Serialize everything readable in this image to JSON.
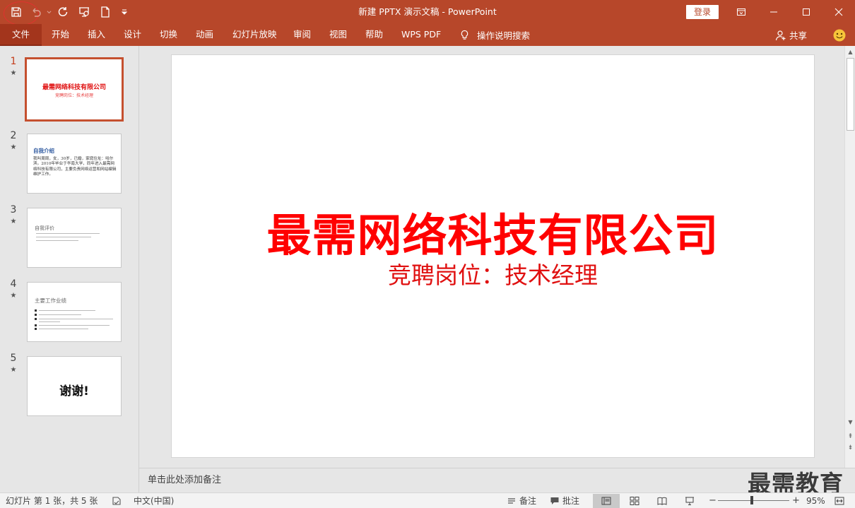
{
  "window": {
    "title": "新建 PPTX 演示文稿  -  PowerPoint",
    "login_label": "登录"
  },
  "ribbon": {
    "file_tab": "文件",
    "tabs": [
      "开始",
      "插入",
      "设计",
      "切换",
      "动画",
      "幻灯片放映",
      "审阅",
      "视图",
      "帮助",
      "WPS PDF"
    ],
    "search_label": "操作说明搜索",
    "share_label": "共享"
  },
  "thumbnails": [
    {
      "number": "1",
      "title": "最需网络科技有限公司",
      "subtitle": "竞聘岗位：技术经理"
    },
    {
      "number": "2",
      "heading": "自我介绍",
      "body": "我叫周周，女，30岁，已婚，家庭住址：哈尔滨。2010年毕业于华南大学，同年进入最需网络科技有限公司，主要负责网络运营和网站编辑维护工作。"
    },
    {
      "number": "3",
      "heading": "自我评价"
    },
    {
      "number": "4",
      "heading": "主要工作业绩"
    },
    {
      "number": "5",
      "text": "谢谢!"
    }
  ],
  "slide": {
    "title": "最需网络科技有限公司",
    "subtitle": "竞聘岗位：技术经理"
  },
  "notes": {
    "placeholder": "单击此处添加备注"
  },
  "watermark": "最需教育",
  "status": {
    "slide_info": "幻灯片 第 1 张，共 5 张",
    "language": "中文(中国)",
    "notes_label": "备注",
    "comments_label": "批注",
    "zoom_out": "−",
    "zoom_in": "+",
    "zoom": "95%"
  },
  "colors": {
    "accent": "#b7472a",
    "title_red": "#ff0000"
  }
}
